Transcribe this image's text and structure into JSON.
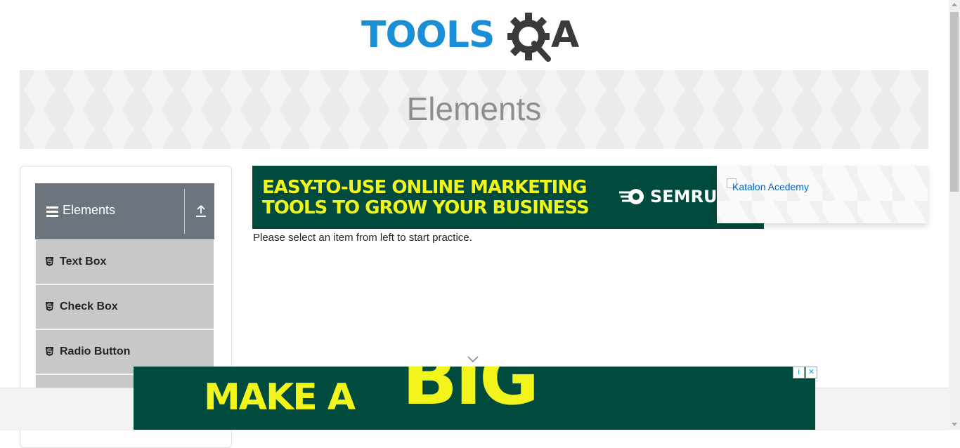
{
  "header": {
    "logo_text_left": "TOOLS",
    "logo_text_right": "A"
  },
  "banner": {
    "title": "Elements"
  },
  "sidebar": {
    "group": {
      "title": "Elements"
    },
    "items": [
      {
        "label": "Text Box"
      },
      {
        "label": "Check Box"
      },
      {
        "label": "Radio Button"
      },
      {
        "label": ""
      }
    ]
  },
  "top_ad": {
    "line1": "EASY-TO-USE ONLINE MARKETING",
    "line2": "TOOLS TO GROW YOUR BUSINESS",
    "brand": "SEMRUSH",
    "colors": {
      "background": "#004b3e",
      "text": "#f1f51c"
    }
  },
  "side_ad": {
    "alt_text": "Katalon Acedemy"
  },
  "main": {
    "practice_text": "Please select an item from left to start practice."
  },
  "bottom_ad": {
    "text_make": "MAKE A",
    "text_big": "BIG",
    "icons": [
      "adchoices-icon",
      "close-icon"
    ]
  },
  "colors": {
    "sidebar_header": "#6c757d",
    "sidebar_item": "#c8c8c8",
    "logo_blue": "#1a8fd6",
    "logo_dark": "#3a3a3a"
  }
}
